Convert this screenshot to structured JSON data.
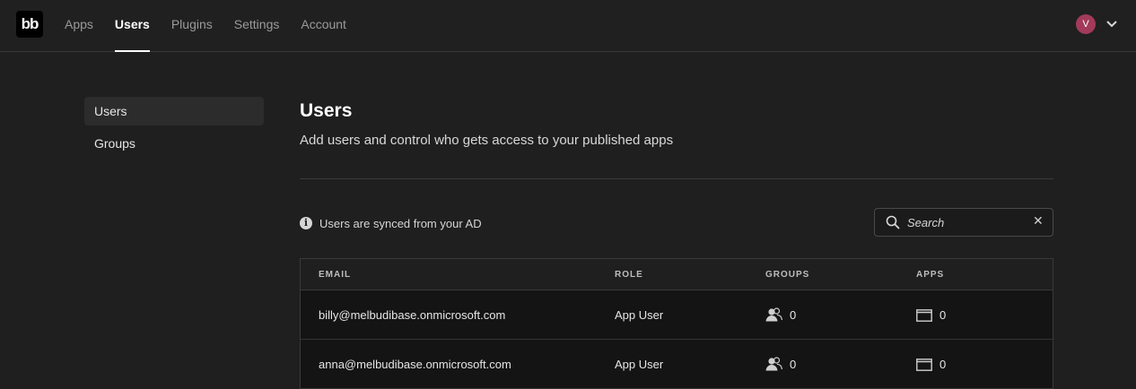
{
  "header": {
    "logo_text": "bb",
    "nav": [
      {
        "label": "Apps"
      },
      {
        "label": "Users"
      },
      {
        "label": "Plugins"
      },
      {
        "label": "Settings"
      },
      {
        "label": "Account"
      }
    ],
    "active_nav": "Users",
    "avatar_initial": "V",
    "avatar_color": "#a23a5b"
  },
  "sidebar": {
    "items": [
      {
        "label": "Users"
      },
      {
        "label": "Groups"
      }
    ],
    "active": "Users"
  },
  "main": {
    "title": "Users",
    "subtitle": "Add users and control who gets access to your published apps",
    "info_text": "Users are synced from your AD",
    "search": {
      "placeholder": "Search",
      "value": ""
    }
  },
  "table": {
    "columns": [
      "EMAIL",
      "ROLE",
      "GROUPS",
      "APPS"
    ],
    "rows": [
      {
        "email": "billy@melbudibase.onmicrosoft.com",
        "role": "App User",
        "groups": "0",
        "apps": "0"
      },
      {
        "email": "anna@melbudibase.onmicrosoft.com",
        "role": "App User",
        "groups": "0",
        "apps": "0"
      }
    ]
  },
  "icons": {
    "info": "info-icon",
    "search": "search-icon",
    "clear": "close-icon",
    "groups": "users-icon",
    "apps": "window-icon",
    "menu": "chevron-down-icon"
  }
}
